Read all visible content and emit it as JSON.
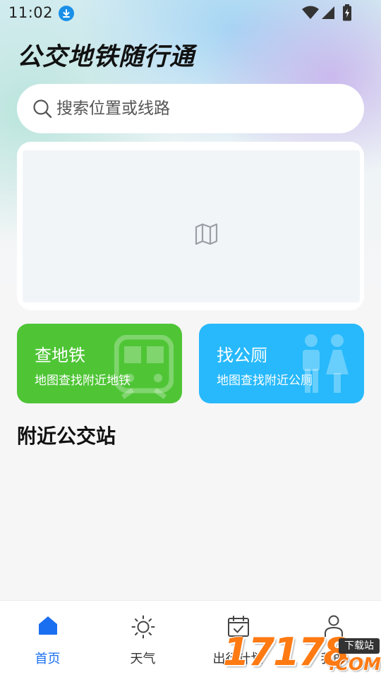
{
  "status_bar": {
    "time": "11:02",
    "icons": [
      "download-icon",
      "wifi-icon",
      "signal-icon",
      "battery-icon"
    ]
  },
  "app": {
    "title": "公交地铁随行通"
  },
  "search": {
    "placeholder": "搜索位置或线路",
    "icon": "search-icon"
  },
  "map": {
    "icon": "map-icon"
  },
  "features": [
    {
      "title": "查地铁",
      "subtitle": "地图查找附近地铁",
      "color": "#4fc536",
      "icon": "train-icon"
    },
    {
      "title": "找公厕",
      "subtitle": "地图查找附近公厕",
      "color": "#27b9fb",
      "icon": "restroom-icon"
    }
  ],
  "nearby": {
    "title": "附近公交站"
  },
  "tabs": [
    {
      "label": "首页",
      "icon": "home-icon",
      "active": true
    },
    {
      "label": "天气",
      "icon": "sun-icon",
      "active": false
    },
    {
      "label": "出行计划",
      "icon": "calendar-check-icon",
      "active": false
    },
    {
      "label": "我的",
      "icon": "user-icon",
      "active": false
    }
  ],
  "colors": {
    "accent": "#1a6ff0",
    "subway_green": "#4fc536",
    "toilet_blue": "#27b9fb"
  },
  "watermark": {
    "digits": "17178",
    "badge": "下载站",
    "suffix": ".COM"
  }
}
